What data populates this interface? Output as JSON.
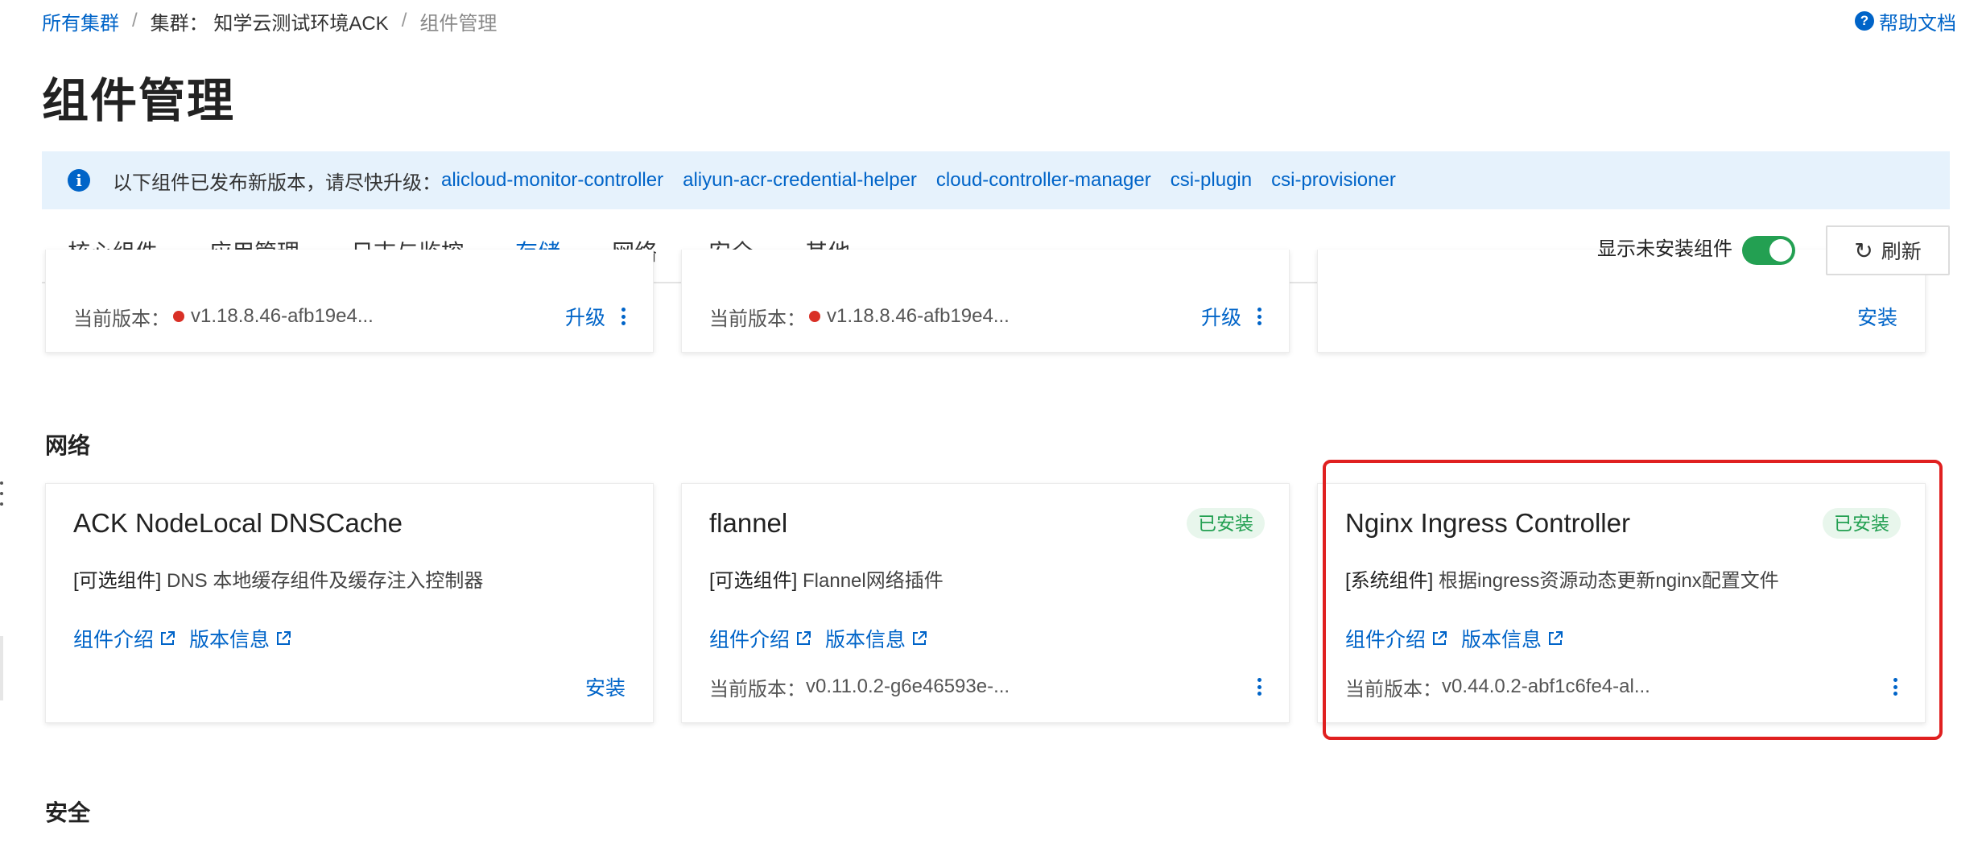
{
  "breadcrumb": {
    "root": "所有集群",
    "cluster": "集群： 知学云测试环境ACK",
    "current": "组件管理"
  },
  "help": {
    "label": "帮助文档",
    "icon": "question-icon"
  },
  "page_title": "组件管理",
  "notice": {
    "icon": "info-icon",
    "text": "以下组件已发布新版本，请尽快升级：",
    "links": [
      "alicloud-monitor-controller",
      "aliyun-acr-credential-helper",
      "cloud-controller-manager",
      "csi-plugin",
      "csi-provisioner"
    ]
  },
  "tabs": [
    "核心组件",
    "应用管理",
    "日志与监控",
    "存储",
    "网络",
    "安全",
    "其他"
  ],
  "active_tab": "存储",
  "toolbar": {
    "toggle_label": "显示未安装组件",
    "toggle_on": true,
    "refresh_label": "刷新",
    "refresh_icon": "refresh-icon"
  },
  "storage_cards": [
    {
      "version_label": "当前版本：",
      "version": "v1.18.8.46-afb19e4...",
      "action": "升级",
      "status_color": "#d93026"
    },
    {
      "version_label": "当前版本：",
      "version": "v1.18.8.46-afb19e4...",
      "action": "升级",
      "status_color": "#d93026"
    },
    {
      "action": "安装"
    }
  ],
  "sections": {
    "network": "网络",
    "security": "安全"
  },
  "network_cards": [
    {
      "name": "ACK NodeLocal DNSCache",
      "tag": "[可选组件]",
      "desc": "DNS 本地缓存组件及缓存注入控制器",
      "intro_link": "组件介绍",
      "version_link": "版本信息",
      "action": "安装"
    },
    {
      "name": "flannel",
      "badge": "已安装",
      "tag": "[可选组件]",
      "desc": "Flannel网络插件",
      "intro_link": "组件介绍",
      "version_link": "版本信息",
      "version_label": "当前版本：",
      "version": "v0.11.0.2-g6e46593e-..."
    },
    {
      "name": "Nginx Ingress Controller",
      "badge": "已安装",
      "tag": "[系统组件]",
      "desc": "根据ingress资源动态更新nginx配置文件",
      "intro_link": "组件介绍",
      "version_link": "版本信息",
      "version_label": "当前版本：",
      "version": "v0.44.0.2-abf1c6fe4-al..."
    }
  ],
  "colors": {
    "accent": "#0064c8",
    "installed_badge_bg": "#e8f6ec",
    "installed_badge_text": "#23a052",
    "toggle_on": "#23a052",
    "highlight": "#e02020"
  }
}
